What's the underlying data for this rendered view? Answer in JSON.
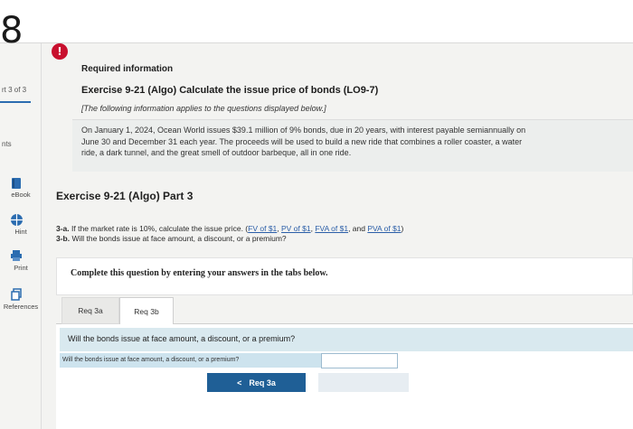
{
  "header": {
    "question_number": "8"
  },
  "sidebar": {
    "part_of": "rt 3 of 3",
    "points_label": "nts",
    "items": [
      {
        "label": "eBook",
        "icon": "book-icon"
      },
      {
        "label": "Hint",
        "icon": "globe-icon"
      },
      {
        "label": "Print",
        "icon": "printer-icon"
      },
      {
        "label": "References",
        "icon": "copy-icon"
      }
    ]
  },
  "info": {
    "alert": "!",
    "required": "Required information",
    "exercise": "Exercise 9-21 (Algo) Calculate the issue price of bonds (LO9-7)",
    "following": "[The following information applies to the questions displayed below.]",
    "line1": "On January 1, 2024, Ocean World issues $39.1 million of 9% bonds, due in 20 years, with interest payable semiannually on",
    "line2": "June 30 and December 31 each year. The proceeds will be used to build a new ride that combines a roller coaster, a water",
    "line3": "ride, a dark tunnel, and the great smell of outdoor barbeque, all in one ride."
  },
  "part": {
    "title": "Exercise 9-21 (Algo) Part 3",
    "q3a_prefix": "3-a.",
    "q3a_text": " If the market rate is 10%, calculate the issue price. (",
    "links": [
      "FV of $1",
      "PV of $1",
      "FVA of $1",
      "PVA of $1"
    ],
    "sep1": ", ",
    "sep2": ", ",
    "sep3": ", and ",
    "close": ")",
    "q3b_prefix": "3-b.",
    "q3b_text": " Will the bonds issue at face amount, a discount, or a premium?"
  },
  "complete": "Complete this question by entering your answers in the tabs below.",
  "tabs": [
    {
      "label": "Req 3a"
    },
    {
      "label": "Req 3b"
    }
  ],
  "panel": {
    "question": "Will the bonds issue at face amount, a discount, or a premium?",
    "answer_label": "Will the bonds issue at face amount, a discount, or a premium?",
    "answer_value": "",
    "prev_button": "Req 3a",
    "prev_arrow": "<"
  },
  "colors": {
    "accent": "#1f5f96",
    "alert": "#c8102e",
    "link": "#2b5ea8"
  }
}
